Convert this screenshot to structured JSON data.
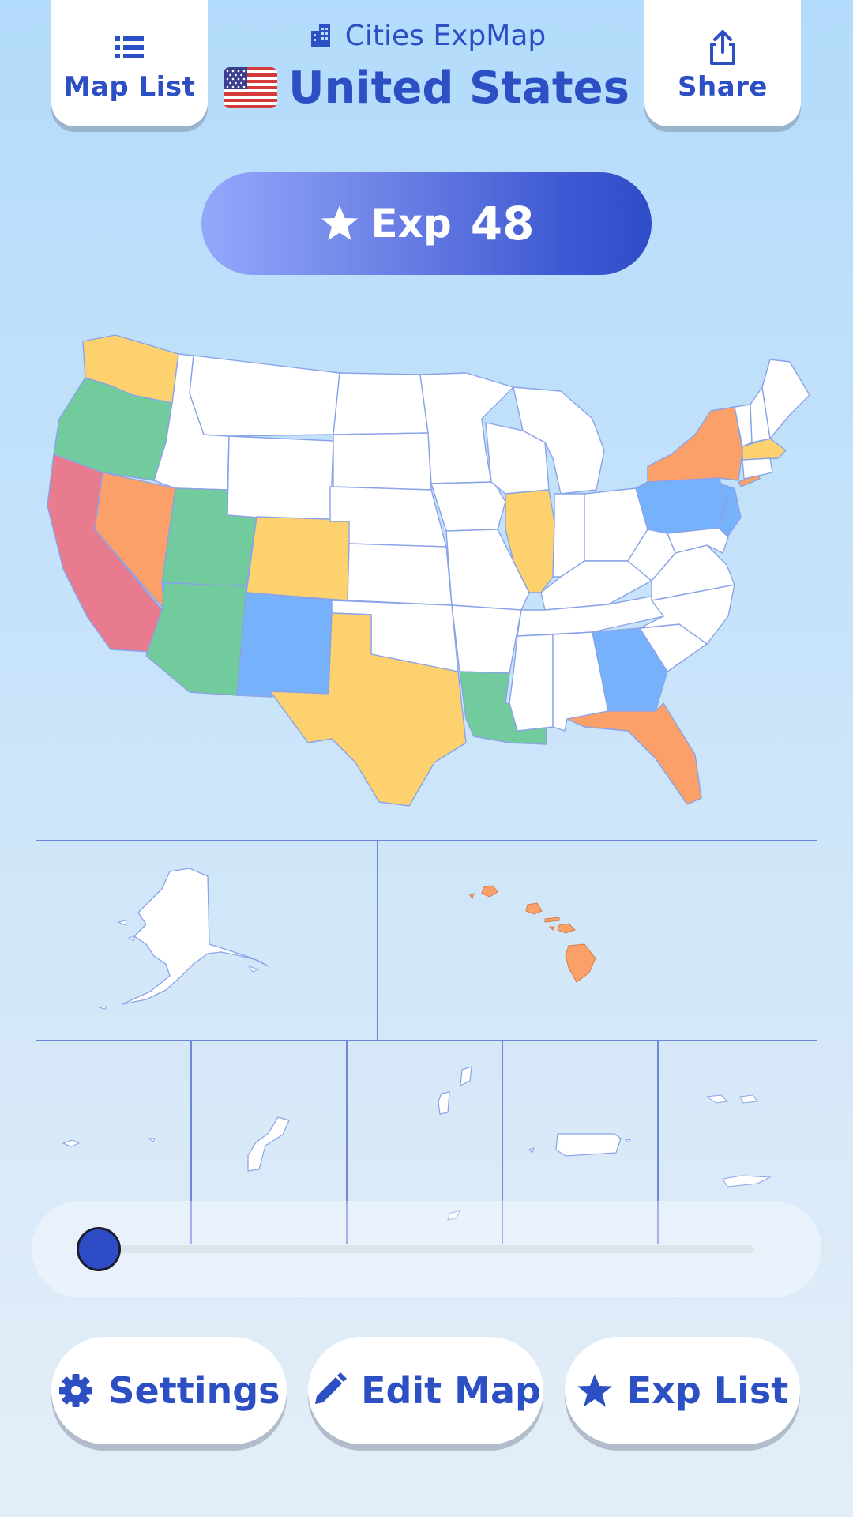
{
  "header": {
    "map_list_label": "Map List",
    "share_label": "Share",
    "app_name": "Cities ExpMap",
    "country": "United States"
  },
  "exp": {
    "label": "Exp",
    "value": "48"
  },
  "slider": {
    "value_fraction": 0.0
  },
  "footer": {
    "settings_label": "Settings",
    "edit_map_label": "Edit Map",
    "exp_list_label": "Exp List"
  },
  "colors": {
    "accent": "#2c4fc4",
    "level_red": "#e97b8e",
    "level_orange": "#fca06a",
    "level_yellow": "#fdd26e",
    "level_green": "#71cb9c",
    "level_blue": "#76b2fb",
    "unvisited": "#ffffff"
  },
  "icons": {
    "map_list": "list-icon",
    "share": "share-icon",
    "app": "city-icon",
    "exp": "star-icon",
    "settings": "gear-icon",
    "edit_map": "pencil-icon",
    "exp_list": "star-icon"
  }
}
